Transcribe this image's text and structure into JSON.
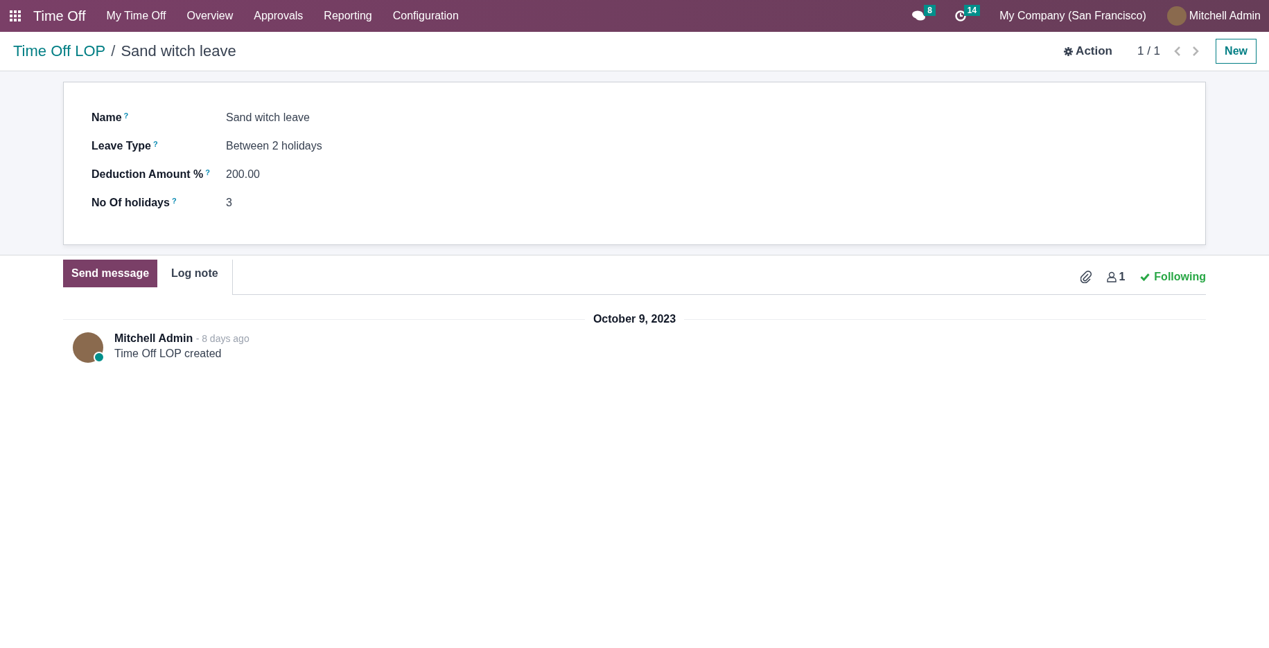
{
  "navbar": {
    "app_name": "Time Off",
    "menu": [
      "My Time Off",
      "Overview",
      "Approvals",
      "Reporting",
      "Configuration"
    ],
    "messages_count": "8",
    "activities_count": "14",
    "company": "My Company (San Francisco)",
    "user": "Mitchell Admin"
  },
  "breadcrumb": {
    "parent": "Time Off LOP",
    "separator": "/",
    "current": "Sand witch leave"
  },
  "control_panel": {
    "action": "Action",
    "pager": "1 / 1",
    "new_button": "New"
  },
  "form": {
    "fields": [
      {
        "label": "Name",
        "value": "Sand witch leave"
      },
      {
        "label": "Leave Type",
        "value": "Between 2 holidays"
      },
      {
        "label": "Deduction Amount %",
        "value": "200.00"
      },
      {
        "label": "No Of holidays",
        "value": "3"
      }
    ],
    "help_mark": "?"
  },
  "chatter": {
    "tabs": [
      {
        "label": "Send message",
        "selected": true
      },
      {
        "label": "Log note",
        "selected": false
      }
    ],
    "followers_count": "1",
    "following": "Following",
    "date_separator": "October 9, 2023",
    "messages": [
      {
        "author": "Mitchell Admin",
        "time": "- 8 days ago",
        "body": "Time Off LOP created",
        "online": true
      }
    ]
  }
}
